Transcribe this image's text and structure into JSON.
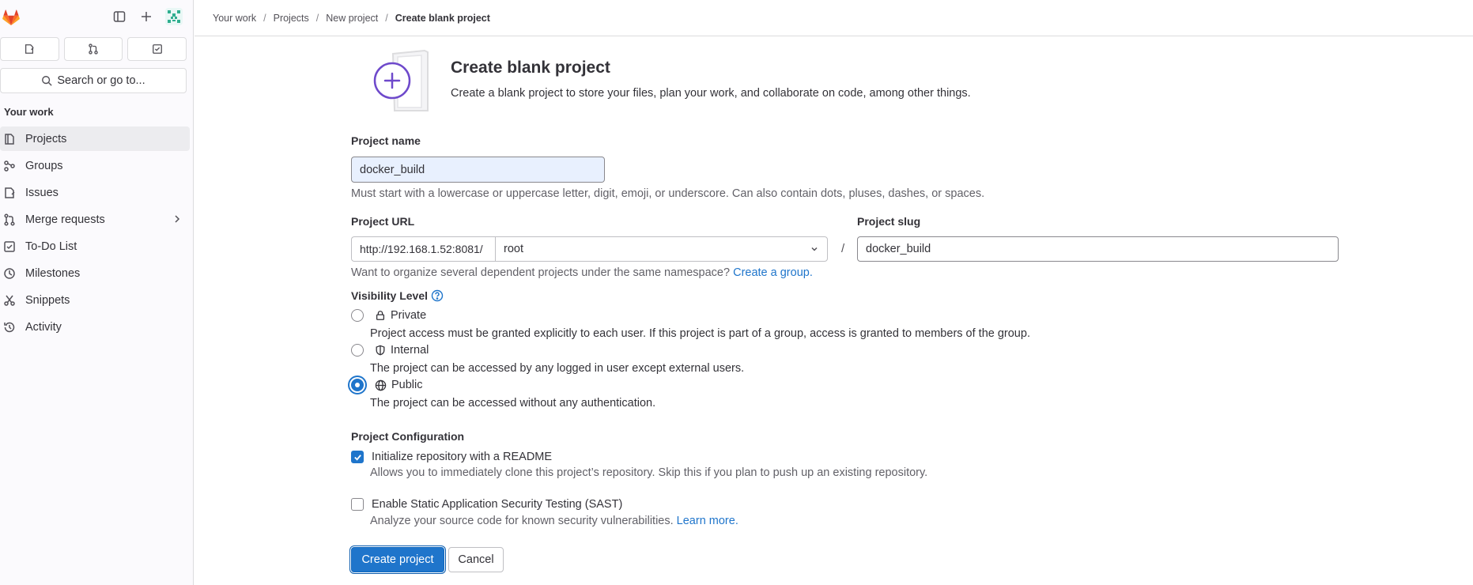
{
  "breadcrumbs": [
    "Your work",
    "Projects",
    "New project",
    "Create blank project"
  ],
  "sidebar": {
    "search_label": "Search or go to...",
    "section_title": "Your work",
    "items": [
      {
        "label": "Projects",
        "icon": "project-icon"
      },
      {
        "label": "Groups",
        "icon": "group-icon"
      },
      {
        "label": "Issues",
        "icon": "issues-icon"
      },
      {
        "label": "Merge requests",
        "icon": "merge-request-icon"
      },
      {
        "label": "To-Do List",
        "icon": "todo-icon"
      },
      {
        "label": "Milestones",
        "icon": "milestone-icon"
      },
      {
        "label": "Snippets",
        "icon": "snippet-icon"
      },
      {
        "label": "Activity",
        "icon": "history-icon"
      }
    ]
  },
  "page": {
    "title": "Create blank project",
    "description": "Create a blank project to store your files, plan your work, and collaborate on code, among other things."
  },
  "form": {
    "project_name_label": "Project name",
    "project_name_value": "docker_build",
    "project_name_help": "Must start with a lowercase or uppercase letter, digit, emoji, or underscore. Can also contain dots, pluses, dashes, or spaces.",
    "project_url_label": "Project URL",
    "url_prefix": "http://192.168.1.52:8081/",
    "namespace_value": "root",
    "slug_separator": "/",
    "project_slug_label": "Project slug",
    "project_slug_value": "docker_build",
    "group_help": "Want to organize several dependent projects under the same namespace?",
    "group_link": "Create a group.",
    "visibility_label": "Visibility Level",
    "visibility": [
      {
        "label": "Private",
        "desc": "Project access must be granted explicitly to each user. If this project is part of a group, access is granted to members of the group.",
        "icon": "lock-icon",
        "checked": false
      },
      {
        "label": "Internal",
        "desc": "The project can be accessed by any logged in user except external users.",
        "icon": "shield-icon",
        "checked": false
      },
      {
        "label": "Public",
        "desc": "The project can be accessed without any authentication.",
        "icon": "earth-icon",
        "checked": true
      }
    ],
    "config_label": "Project Configuration",
    "readme_label": "Initialize repository with a README",
    "readme_desc": "Allows you to immediately clone this project’s repository. Skip this if you plan to push up an existing repository.",
    "readme_checked": true,
    "sast_label": "Enable Static Application Security Testing (SAST)",
    "sast_desc": "Analyze your source code for known security vulnerabilities.",
    "sast_link": "Learn more.",
    "sast_checked": false,
    "create_button": "Create project",
    "cancel_button": "Cancel"
  },
  "colors": {
    "primary": "#1f75cb",
    "sidebar_bg": "#fbfafd",
    "active_item_bg": "#ececef",
    "illustration_purple": "#6e49cb"
  }
}
